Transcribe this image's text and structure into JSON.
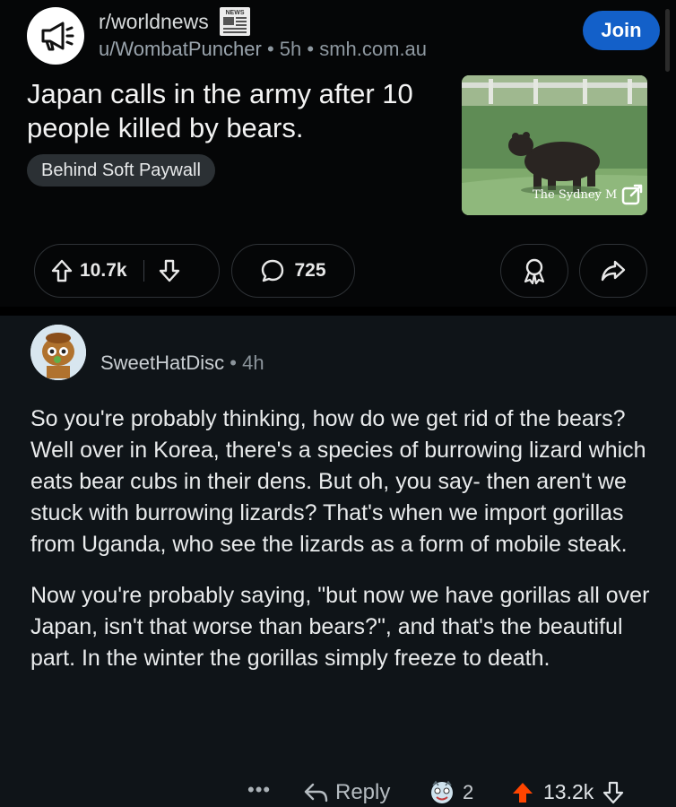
{
  "post": {
    "subreddit": "r/worldnews",
    "author": "u/WombatPuncher",
    "age": "5h",
    "domain": "smh.com.au",
    "join_label": "Join",
    "title": "Japan calls in the army after 10 people killed by bears.",
    "flair": "Behind Soft Paywall",
    "thumbnail_source": "The Sydney M",
    "score": "10.7k",
    "comment_count": "725",
    "badge_text": "NEWS"
  },
  "comment": {
    "username": "SweetHatDisc",
    "age": "4h",
    "paragraphs": [
      "So you're probably thinking, how do we get rid of the bears? Well over in Korea, there's a species of burrowing lizard which eats bear cubs in their dens. But oh, you say- then aren't we stuck with burrowing lizards? That's when we import gorillas from Uganda, who see the lizards as a form of mobile steak.",
      "Now you're probably saying, \"but now we have gorillas all over Japan, isn't that worse than bears?\", and that's the beautiful part. In the winter the gorillas simply freeze to death."
    ],
    "more_label": "•••",
    "reply_label": "Reply",
    "award_count": "2",
    "score": "13.2k"
  },
  "colors": {
    "join": "#1360c9",
    "upvote_active": "#ff4500",
    "comment_bg": "#0f1418"
  },
  "icons": [
    "megaphone-icon",
    "news-badge-icon",
    "external-link-icon",
    "upvote-icon",
    "downvote-icon",
    "comment-bubble-icon",
    "award-icon",
    "share-icon",
    "reply-arrow-icon"
  ]
}
